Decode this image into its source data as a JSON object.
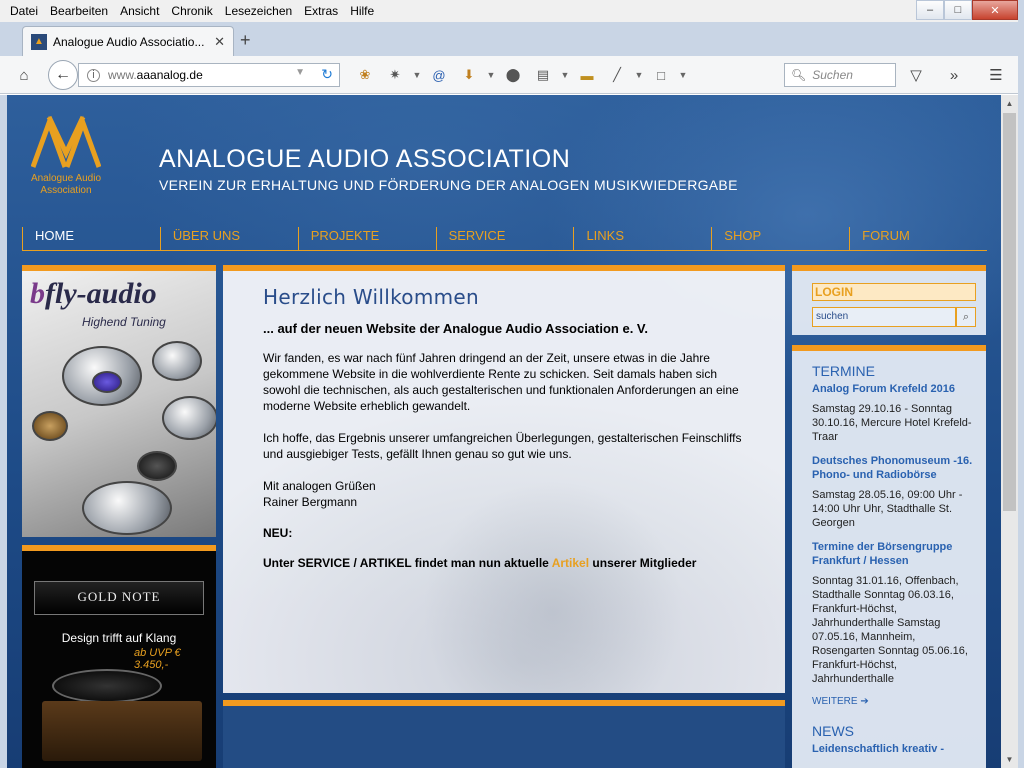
{
  "browser": {
    "menu": [
      "Datei",
      "Bearbeiten",
      "Ansicht",
      "Chronik",
      "Lesezeichen",
      "Extras",
      "Hilfe"
    ],
    "tab_title": "Analogue Audio Associatio...",
    "url_prefix": "www.",
    "url_domain": "aaanalog.de",
    "search_placeholder": "Suchen"
  },
  "site": {
    "logo_line1": "Analogue Audio",
    "logo_line2": "Association",
    "title": "ANALOGUE AUDIO ASSOCIATION",
    "subtitle": "VEREIN ZUR ERHALTUNG UND FÖRDERUNG DER ANALOGEN MUSIKWIEDERGABE",
    "nav": [
      "HOME",
      "ÜBER UNS",
      "PROJEKTE",
      "SERVICE",
      "LINKS",
      "SHOP",
      "FORUM"
    ],
    "accent_color": "#e8a020"
  },
  "banners": {
    "flyaudio_brand_b": "b",
    "flyaudio_brand": "fly-audio",
    "flyaudio_tagline": "Highend Tuning",
    "goldnote_brand": "GOLD NOTE",
    "goldnote_claim": "Design trifft auf Klang",
    "goldnote_price": "ab UVP € 3.450,-"
  },
  "content": {
    "heading": "Herzlich Willkommen",
    "lead": "... auf der neuen Website der Analogue Audio Association e. V.",
    "p1": "Wir fanden, es war nach fünf Jahren dringend an der Zeit, unsere etwas in die Jahre gekommene Website in die wohlverdiente Rente zu schicken. Seit damals haben sich sowohl die technischen, als auch gestalterischen und funktionalen Anforderungen an eine moderne Website erheblich gewandelt.",
    "p2": "Ich hoffe, das Ergebnis unserer umfangreichen Überlegungen, gestalterischen Feinschliffs und ausgiebiger Tests, gefällt Ihnen genau so gut wie uns.",
    "greeting": "Mit analogen Grüßen",
    "signature": "Rainer Bergmann",
    "neu_label": "NEU:",
    "artikel_before": "Unter SERVICE / ARTIKEL findet man nun aktuelle ",
    "artikel_link": "Artikel",
    "artikel_after": " unserer Mitglieder"
  },
  "sidebar": {
    "login_label": "LOGIN",
    "search_placeholder": "suchen",
    "termine_title": "TERMINE",
    "events": [
      {
        "title": "Analog Forum Krefeld 2016",
        "text": "Samstag 29.10.16 - Sonntag 30.10.16, Mercure Hotel Krefeld-Traar"
      },
      {
        "title": "Deutsches Phonomuseum -16. Phono- und Radiobörse",
        "text": "Samstag 28.05.16, 09:00 Uhr - 14:00 Uhr Uhr, Stadthalle St. Georgen"
      },
      {
        "title": "Termine der Börsengruppe Frankfurt / Hessen",
        "text": "Sonntag 31.01.16, Offenbach, Stadthalle Sonntag 06.03.16, Frankfurt-Höchst, Jahrhunderthalle Samstag 07.05.16, Mannheim, Rosengarten Sonntag 05.06.16, Frankfurt-Höchst, Jahrhunderthalle"
      }
    ],
    "weiter_label": "WEITERE",
    "news_title": "NEWS",
    "news_first": "Leidenschaftlich kreativ -"
  }
}
